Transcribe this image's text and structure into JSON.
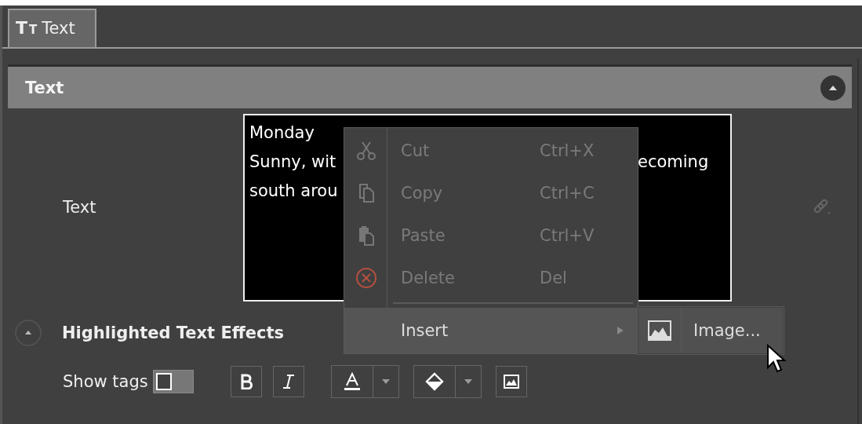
{
  "tabs": [
    {
      "label": "Text",
      "icon": [
        "T",
        "T"
      ],
      "selected": true
    }
  ],
  "section": {
    "title": "Text",
    "expanded": true
  },
  "text_field": {
    "label": "Text",
    "visible_lines": [
      {
        "left": "Monday"
      },
      {
        "left": "Sunny, wit",
        "right": "ecoming"
      },
      {
        "left": "south arou"
      }
    ]
  },
  "effects": {
    "title": "Highlighted Text Effects",
    "expanded": true
  },
  "toolbar": {
    "show_tags_label": "Show tags",
    "show_tags_on": false
  },
  "context_menu": {
    "items": [
      {
        "kind": "command",
        "label": "Cut",
        "shortcut": "Ctrl+X",
        "disabled": true,
        "selected": false
      },
      {
        "kind": "command",
        "label": "Copy",
        "shortcut": "Ctrl+C",
        "disabled": true,
        "selected": false
      },
      {
        "kind": "command",
        "label": "Paste",
        "shortcut": "Ctrl+V",
        "disabled": true,
        "selected": false
      },
      {
        "kind": "command",
        "label": "Delete",
        "shortcut": "Del",
        "disabled": true,
        "selected": false
      },
      {
        "kind": "separator"
      },
      {
        "kind": "submenu",
        "label": "Insert",
        "disabled": false,
        "selected": true
      }
    ]
  },
  "submenu": {
    "items": [
      {
        "label": "Image...",
        "selected": true
      }
    ]
  }
}
